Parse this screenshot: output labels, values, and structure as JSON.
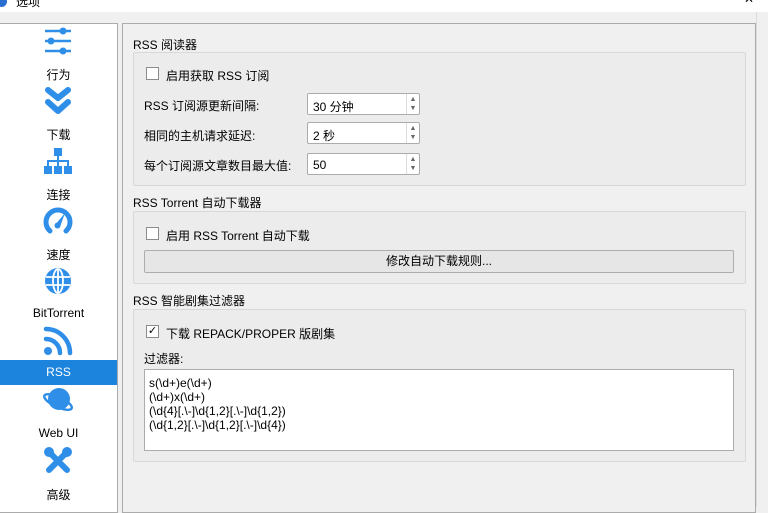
{
  "window": {
    "title": "选项"
  },
  "sidebar": {
    "items": [
      {
        "label": "行为",
        "icon": "sliders-icon"
      },
      {
        "label": "下载",
        "icon": "double-chevron-down-icon"
      },
      {
        "label": "连接",
        "icon": "network-icon"
      },
      {
        "label": "速度",
        "icon": "speedometer-icon"
      },
      {
        "label": "BitTorrent",
        "icon": "globe-icon"
      },
      {
        "label": "RSS",
        "icon": "rss-icon",
        "selected": true
      },
      {
        "label": "Web UI",
        "icon": "planet-icon"
      },
      {
        "label": "高级",
        "icon": "tools-icon"
      }
    ]
  },
  "reader": {
    "title": "RSS 阅读器",
    "enable_label": "启用获取 RSS 订阅",
    "enabled": false,
    "interval_label": "RSS 订阅源更新间隔:",
    "interval_value": "30 分钟",
    "delay_label": "相同的主机请求延迟:",
    "delay_value": "2 秒",
    "max_label": "每个订阅源文章数目最大值:",
    "max_value": "50"
  },
  "downloader": {
    "title": "RSS Torrent 自动下载器",
    "enable_label": "启用 RSS Torrent 自动下载",
    "enabled": false,
    "edit_rules_label": "修改自动下载规则..."
  },
  "smart_filter": {
    "title": "RSS 智能剧集过滤器",
    "repack_label": "下载 REPACK/PROPER 版剧集",
    "repack_checked": true,
    "filters_label": "过滤器:",
    "filters": [
      "s(\\d+)e(\\d+)",
      "(\\d+)x(\\d+)",
      "(\\d{4}[.\\-]\\d{1,2}[.\\-]\\d{1,2})",
      "(\\d{1,2}[.\\-]\\d{1,2}[.\\-]\\d{4})"
    ]
  },
  "colors": {
    "accent": "#1c84dc",
    "icon": "#2f8fe8"
  }
}
